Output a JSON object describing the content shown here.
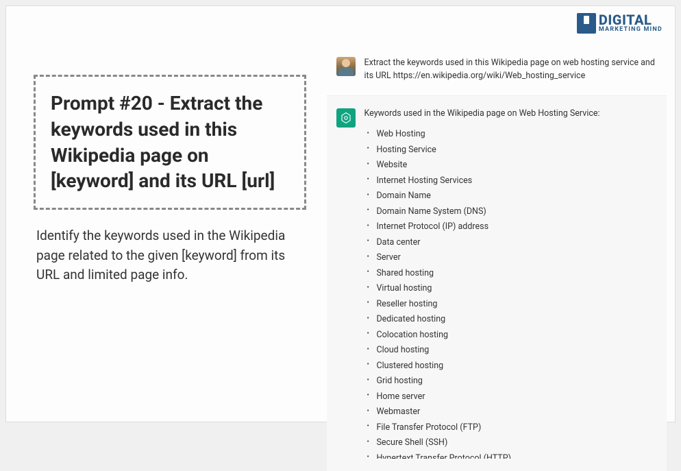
{
  "logo": {
    "main": "DIGITAL",
    "sub": "MARKETING MIND"
  },
  "prompt": {
    "title": "Prompt #20 - Extract the keywords used in this Wikipedia page on [keyword] and its URL [url]",
    "description": "Identify the keywords used in the Wikipedia page related to the given [keyword] from its URL and limited page info."
  },
  "chat": {
    "user_message": "Extract the keywords used in this Wikipedia page on web hosting service and its URL https://en.wikipedia.org/wiki/Web_hosting_service",
    "ai_heading": "Keywords used in the Wikipedia page on Web Hosting Service:",
    "keywords": [
      "Web Hosting",
      "Hosting Service",
      "Website",
      "Internet Hosting Services",
      "Domain Name",
      "Domain Name System (DNS)",
      "Internet Protocol (IP) address",
      "Data center",
      "Server",
      "Shared hosting",
      "Virtual hosting",
      "Reseller hosting",
      "Dedicated hosting",
      "Colocation hosting",
      "Cloud hosting",
      "Clustered hosting",
      "Grid hosting",
      "Home server",
      "Webmaster",
      "File Transfer Protocol (FTP)",
      "Secure Shell (SSH)"
    ],
    "keyword_cutoff": "Hypertext Transfer Protocol (HTTP)"
  }
}
